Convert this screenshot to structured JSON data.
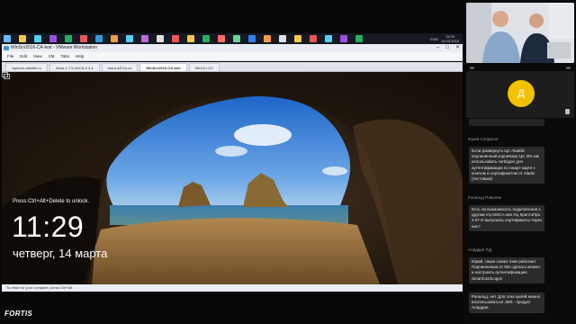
{
  "taskbar": {
    "icons": [
      {
        "name": "start-icon",
        "color": "#6ab7ff"
      },
      {
        "name": "files-icon",
        "color": "#f2c94c"
      },
      {
        "name": "app-icon-2",
        "color": "#56ccf2"
      },
      {
        "name": "app-icon-3",
        "color": "#9b51e0"
      },
      {
        "name": "app-icon-4",
        "color": "#27ae60"
      },
      {
        "name": "app-icon-5",
        "color": "#eb5757"
      },
      {
        "name": "app-icon-6",
        "color": "#2d9cdb"
      },
      {
        "name": "app-icon-7",
        "color": "#f2994a"
      },
      {
        "name": "app-icon-8",
        "color": "#56ccf2"
      },
      {
        "name": "app-icon-9",
        "color": "#bb6bd9"
      },
      {
        "name": "app-icon-10",
        "color": "#e0e0e0"
      },
      {
        "name": "app-icon-11",
        "color": "#eb5757"
      },
      {
        "name": "app-icon-12",
        "color": "#f2c94c"
      },
      {
        "name": "app-icon-13",
        "color": "#27ae60"
      },
      {
        "name": "app-icon-14",
        "color": "#ff6b6b"
      },
      {
        "name": "app-icon-15",
        "color": "#6fcf97"
      },
      {
        "name": "app-icon-16",
        "color": "#2f80ed"
      },
      {
        "name": "app-icon-17",
        "color": "#f2994a"
      },
      {
        "name": "app-icon-18",
        "color": "#e0e0e0"
      },
      {
        "name": "app-icon-19",
        "color": "#f2c94c"
      },
      {
        "name": "app-icon-20",
        "color": "#eb5757"
      },
      {
        "name": "app-icon-21",
        "color": "#56ccf2"
      },
      {
        "name": "app-icon-22",
        "color": "#9b51e0"
      },
      {
        "name": "app-icon-23",
        "color": "#27ae60"
      }
    ],
    "lang": "ENG",
    "clock_time": "11:29",
    "clock_date": "14.03.2024"
  },
  "vmware": {
    "title": "WinSrv2016-CA-test - VMware Workstation",
    "menu": [
      "File",
      "Edit",
      "View",
      "VM",
      "Tabs",
      "Help"
    ],
    "tabs": [
      "vsphere.aladdin.ru",
      "Astra-1.7.5-AeCA-2.4 a",
      "Astra-AECA-cs",
      "WinSrv2016-CA-test",
      "Win10-LDC"
    ],
    "active_tab": 3,
    "status_text": "To return to your computer, press Ctrl+Alt."
  },
  "lockscreen": {
    "hint": "Press Ctrl+Alt+Delete to unlock.",
    "time": "11:29",
    "date": "четверг, 14 марта"
  },
  "brand": "FORTIS",
  "participant": {
    "initial": "Д",
    "color": "#f2c200"
  },
  "chat": [
    {
      "author": "",
      "text": ""
    },
    {
      "author": "Юрий Солдатов",
      "text": "Если развернуть ЦС Aladdin подчиненный корневому ЦС MS как использовать certlogon для аутентификации по смарт-карте с ключом и сертификатом от Aladin (тестовым)"
    },
    {
      "author": "Рональд Поволяк",
      "text": "Есть ли возможность подключения к другим УЦ MSCA или УЦ КриптоПро 2.0? И выпускать сертификаты через них?"
    },
    {
      "author": "Аладдин Р.Д.",
      "text": "Юрий, такая схема тоже работает. Подчиненным от MS сделать можно и настроить аутентификацию SmartCardLogon"
    },
    {
      "author": "",
      "text": "Рональд, нет. Для этих целей можно воспользоваться JMS - продукт Аладдин."
    }
  ]
}
